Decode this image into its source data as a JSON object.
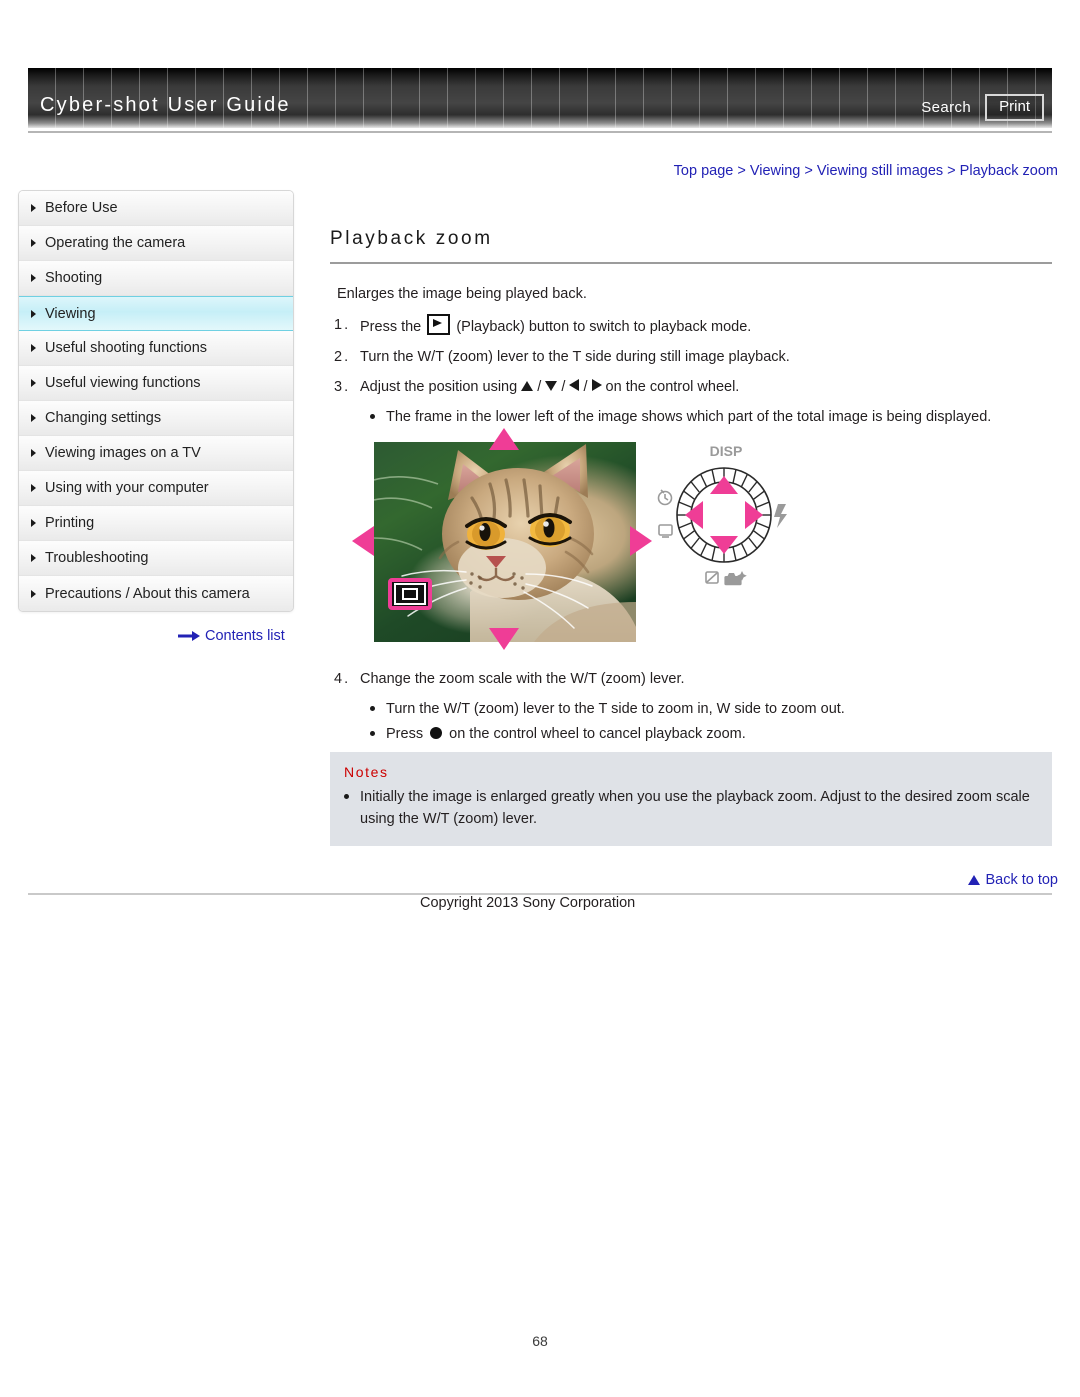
{
  "header": {
    "title": "Cyber-shot User Guide",
    "search_label": "Search",
    "print_label": "Print"
  },
  "sidebar": {
    "items": [
      {
        "label": "Before Use",
        "active": false
      },
      {
        "label": "Operating the camera",
        "active": false
      },
      {
        "label": "Shooting",
        "active": false
      },
      {
        "label": "Viewing",
        "active": true
      },
      {
        "label": "Useful shooting functions",
        "active": false
      },
      {
        "label": "Useful viewing functions",
        "active": false
      },
      {
        "label": "Changing settings",
        "active": false
      },
      {
        "label": "Viewing images on a TV",
        "active": false
      },
      {
        "label": "Using with your computer",
        "active": false
      },
      {
        "label": "Printing",
        "active": false
      },
      {
        "label": "Troubleshooting",
        "active": false
      },
      {
        "label": "Precautions / About this camera",
        "active": false
      }
    ],
    "contents_link": "Contents list"
  },
  "main": {
    "breadcrumb": "Top page > Viewing > Viewing still images > Playback zoom",
    "title": "Playback zoom",
    "intro": "Enlarges the image being played back.",
    "steps": [
      {
        "number": "1.",
        "pre": "Press the",
        "icon": "playback-button-icon",
        "post": "(Playback) button to switch to playback mode."
      },
      {
        "number": "2.",
        "pre": "Turn the W/T (zoom) lever to the T side during still image playback.",
        "icon": "",
        "post": ""
      },
      {
        "number": "3.",
        "pre": "Adjust the position using",
        "icon": "direction-triangles",
        "post": "on the control wheel."
      }
    ],
    "step3_bullet": "The frame in the lower left of the image shows which part of the total image is being displayed.",
    "step4": {
      "number": "4.",
      "text": "Change the zoom scale with the W/T (zoom) lever.",
      "bullets": [
        {
          "pre": "Turn the W/T (zoom) lever to the T side to zoom in, W side to zoom out.",
          "icon": "",
          "post": ""
        },
        {
          "pre": "Press",
          "icon": "center-button-icon",
          "post": "on the control wheel to cancel playback zoom."
        }
      ]
    }
  },
  "figure": {
    "photo_alt": "playback-zoom-cat-photo",
    "frame_indicator": "position-frame-indicator",
    "wheel": {
      "disp_label": "DISP",
      "icons": [
        "self-timer-icon",
        "burst-mode-icon",
        "flash-icon",
        "exposure-icon",
        "photo-creativity-icon"
      ]
    }
  },
  "notes": {
    "title": "Notes",
    "items": [
      "Initially the image is enlarged greatly when you use the playback zoom. Adjust to the desired zoom scale using the W/T (zoom) lever."
    ]
  },
  "footer": {
    "back_to_top": "Back to top",
    "copyright": "Copyright 2013 Sony Corporation",
    "page_number": "68"
  },
  "colors": {
    "link": "#2222b5",
    "accent_pink": "#ef3d96",
    "notes_bg": "#dfe2e7",
    "notes_title": "#cc0000",
    "active_nav": "#c6eff7"
  }
}
